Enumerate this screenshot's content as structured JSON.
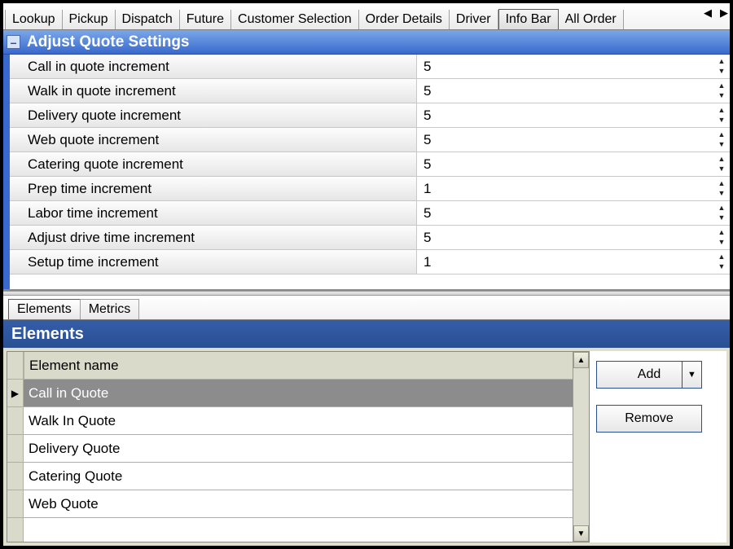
{
  "top_tabs": {
    "items": [
      "Lookup",
      "Pickup",
      "Dispatch",
      "Future",
      "Customer Selection",
      "Order Details",
      "Driver",
      "Info Bar",
      "All Order"
    ],
    "active_index": 7
  },
  "propgrid": {
    "title": "Adjust Quote Settings",
    "rows": [
      {
        "label": "Call in quote increment",
        "value": "5"
      },
      {
        "label": "Walk in quote increment",
        "value": "5"
      },
      {
        "label": "Delivery quote increment",
        "value": "5"
      },
      {
        "label": "Web quote increment",
        "value": "5"
      },
      {
        "label": "Catering quote increment",
        "value": "5"
      },
      {
        "label": "Prep time increment",
        "value": "1"
      },
      {
        "label": "Labor time increment",
        "value": "5"
      },
      {
        "label": "Adjust drive time increment",
        "value": "5"
      },
      {
        "label": "Setup time increment",
        "value": "1"
      }
    ]
  },
  "lower_tabs": {
    "items": [
      "Elements",
      "Metrics"
    ],
    "active_index": 0
  },
  "elements_panel": {
    "title": "Elements",
    "column_header": "Element name",
    "rows": [
      "Call in Quote",
      "Walk In Quote",
      "Delivery Quote",
      "Catering Quote",
      "Web Quote"
    ],
    "selected_index": 0
  },
  "buttons": {
    "add": "Add",
    "remove": "Remove"
  }
}
